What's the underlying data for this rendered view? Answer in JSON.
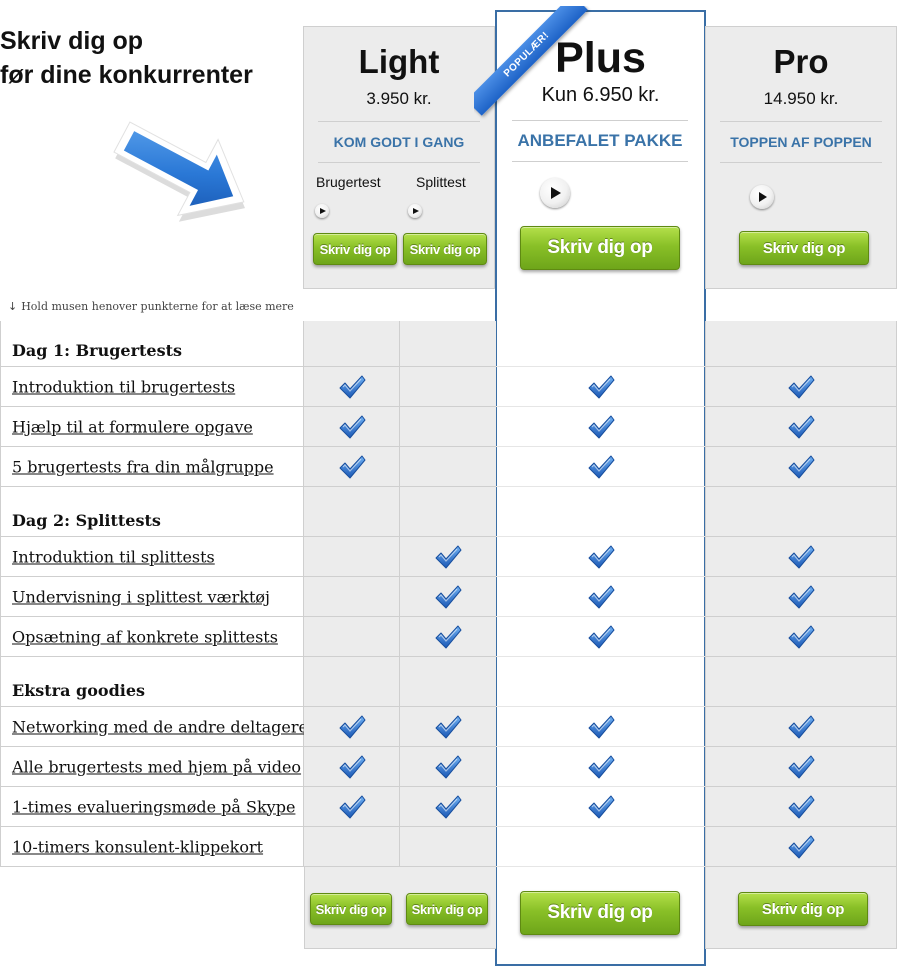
{
  "headline": {
    "line1": "Skriv dig op",
    "line2": "før dine konkurrenter"
  },
  "icons": {
    "arrow": "blue-arrow-icon",
    "play": "play-icon",
    "check": "checkmark-icon",
    "hint_arrow": "down-arrow-icon"
  },
  "colors": {
    "accent_blue": "#3a73a8",
    "plus_border": "#3a6ea5",
    "button_green": "#89c027",
    "panel_gray": "#ececec",
    "ribbon_blue": "#2f78d9",
    "check_blue": "#2c6fd0"
  },
  "hint": {
    "arrow": "↓",
    "text": "Hold musen henover punkterne for at læse mere"
  },
  "plans": {
    "light": {
      "name": "Light",
      "price": "3.950 kr.",
      "tag": "KOM GODT I GANG",
      "options": [
        {
          "label": "Brugertest",
          "button": "Skriv dig op"
        },
        {
          "label": "Splittest",
          "button": "Skriv dig op"
        }
      ]
    },
    "plus": {
      "ribbon": "POPULÆR!",
      "name": "Plus",
      "price": "Kun 6.950 kr.",
      "tag": "ANBEFALET PAKKE",
      "button": "Skriv dig op"
    },
    "pro": {
      "name": "Pro",
      "price": "14.950 kr.",
      "tag": "TOPPEN AF POPPEN",
      "button": "Skriv dig op"
    }
  },
  "sections": [
    {
      "title": "Dag 1: Brugertests",
      "features": [
        {
          "label": "Introduktion til brugertests",
          "light": true,
          "split": false,
          "plus": true,
          "pro": true
        },
        {
          "label": "Hjælp til at formulere opgave",
          "light": true,
          "split": false,
          "plus": true,
          "pro": true
        },
        {
          "label": "5 brugertests fra din målgruppe",
          "light": true,
          "split": false,
          "plus": true,
          "pro": true
        }
      ]
    },
    {
      "title": "Dag 2: Splittests",
      "features": [
        {
          "label": "Introduktion til splittests",
          "light": false,
          "split": true,
          "plus": true,
          "pro": true
        },
        {
          "label": "Undervisning i splittest værktøj",
          "light": false,
          "split": true,
          "plus": true,
          "pro": true
        },
        {
          "label": "Opsætning af konkrete splittests",
          "light": false,
          "split": true,
          "plus": true,
          "pro": true
        }
      ]
    },
    {
      "title": "Ekstra goodies",
      "features": [
        {
          "label": "Networking med de andre deltagere",
          "light": true,
          "split": true,
          "plus": true,
          "pro": true
        },
        {
          "label": "Alle brugertests med hjem på video",
          "light": true,
          "split": true,
          "plus": true,
          "pro": true
        },
        {
          "label": "1-times evalueringsmøde på Skype",
          "light": true,
          "split": true,
          "plus": true,
          "pro": true
        },
        {
          "label": "10-timers konsulent-klippekort",
          "light": false,
          "split": false,
          "plus": false,
          "pro": true
        }
      ]
    }
  ],
  "footer": {
    "light_button": "Skriv dig op",
    "split_button": "Skriv dig op",
    "plus_button": "Skriv dig op",
    "pro_button": "Skriv dig op"
  }
}
